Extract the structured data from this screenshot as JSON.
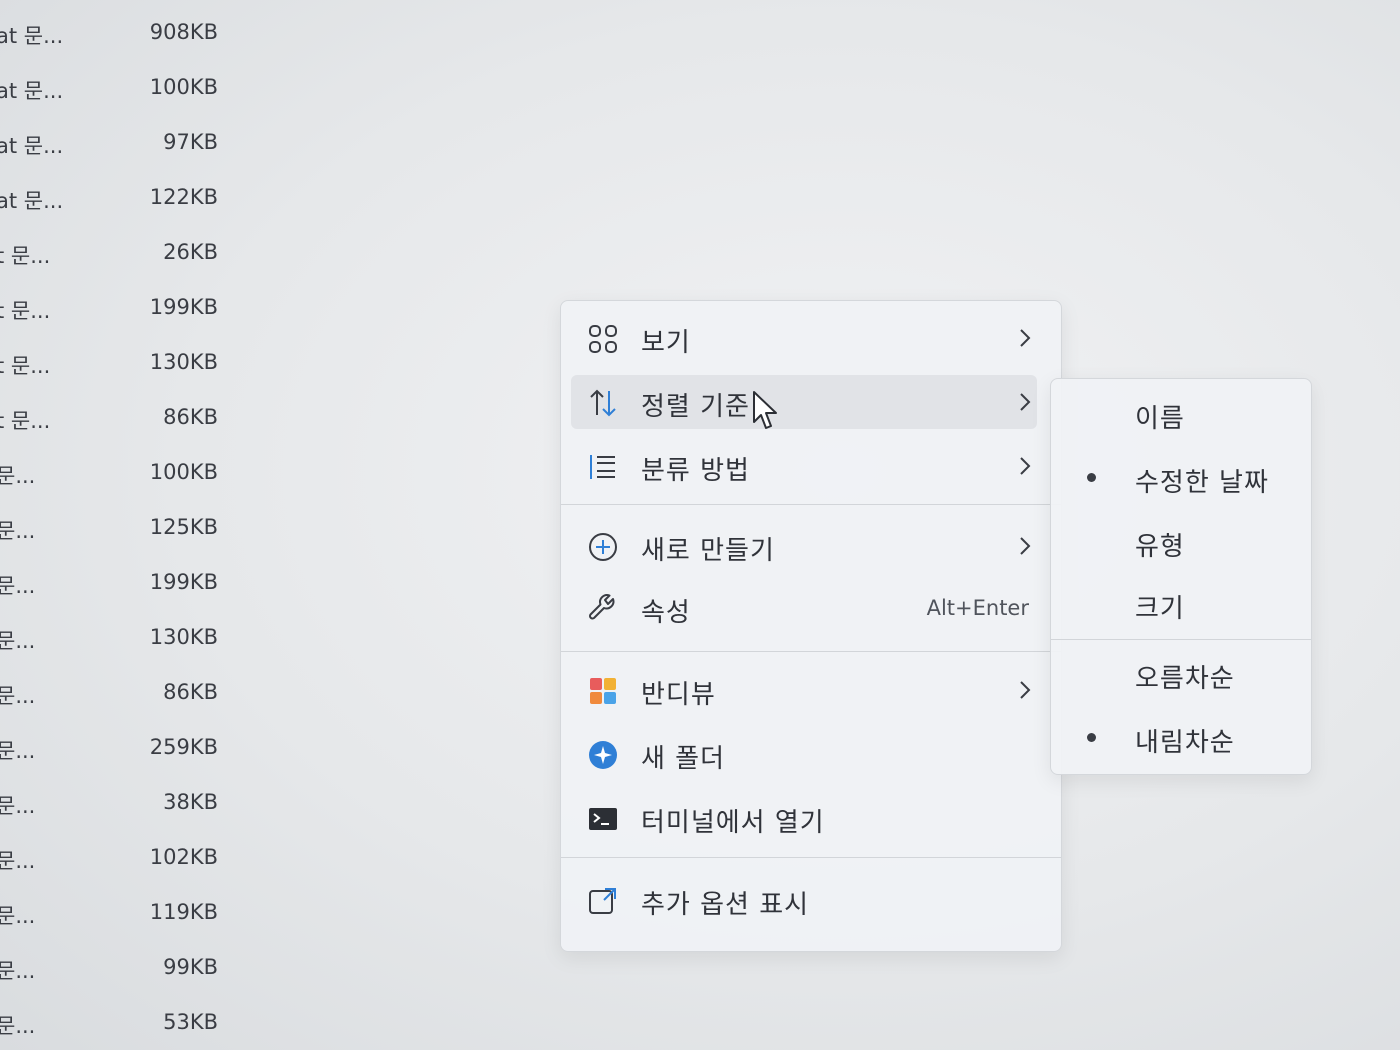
{
  "files": [
    {
      "name": "at 문...",
      "size": "908KB"
    },
    {
      "name": "at 문...",
      "size": "100KB"
    },
    {
      "name": "at 문...",
      "size": "97KB"
    },
    {
      "name": "at 문...",
      "size": "122KB"
    },
    {
      "name": "t 문...",
      "size": "26KB"
    },
    {
      "name": "t 문...",
      "size": "199KB"
    },
    {
      "name": "t 문...",
      "size": "130KB"
    },
    {
      "name": "t 문...",
      "size": "86KB"
    },
    {
      "name": "문...",
      "size": "100KB"
    },
    {
      "name": "문...",
      "size": "125KB"
    },
    {
      "name": "문...",
      "size": "199KB"
    },
    {
      "name": "문...",
      "size": "130KB"
    },
    {
      "name": "문...",
      "size": "86KB"
    },
    {
      "name": "문...",
      "size": "259KB"
    },
    {
      "name": "문...",
      "size": "38KB"
    },
    {
      "name": "문...",
      "size": "102KB"
    },
    {
      "name": "문...",
      "size": "119KB"
    },
    {
      "name": "문...",
      "size": "99KB"
    },
    {
      "name": "문...",
      "size": "53KB"
    }
  ],
  "context_menu": {
    "items": [
      {
        "label": "보기",
        "icon": "view-grid-icon",
        "has_submenu": true
      },
      {
        "label": "정렬 기준",
        "icon": "sort-icon",
        "has_submenu": true,
        "hovered": true
      },
      {
        "label": "분류 방법",
        "icon": "group-by-icon",
        "has_submenu": true
      },
      {
        "label": "새로 만들기",
        "icon": "new-plus-icon",
        "has_submenu": true
      },
      {
        "label": "속성",
        "icon": "wrench-icon",
        "shortcut": "Alt+Enter"
      },
      {
        "label": "반디뷰",
        "icon": "bandiview-app-icon",
        "has_submenu": true
      },
      {
        "label": "새 폴더",
        "icon": "new-folder-app-icon"
      },
      {
        "label": "터미널에서 열기",
        "icon": "terminal-icon"
      },
      {
        "label": "추가 옵션 표시",
        "icon": "more-options-icon"
      }
    ]
  },
  "sort_submenu": {
    "items": [
      {
        "label": "이름",
        "selected": false
      },
      {
        "label": "수정한 날짜",
        "selected": true
      },
      {
        "label": "유형",
        "selected": false
      },
      {
        "label": "크기",
        "selected": false
      },
      {
        "label": "오름차순",
        "selected": false
      },
      {
        "label": "내림차순",
        "selected": true
      }
    ]
  },
  "colors": {
    "menu_bg": "#f0f2f5",
    "hover_bg": "#e1e3e7",
    "text": "#30333a",
    "accent_blue": "#2f7fd6"
  }
}
